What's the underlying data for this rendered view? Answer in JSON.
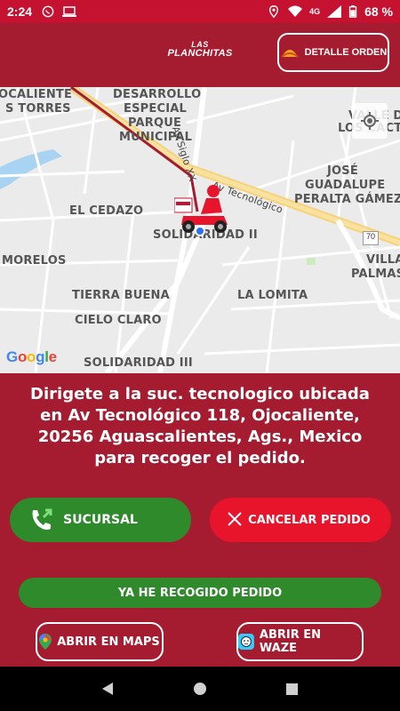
{
  "statusbar": {
    "time": "2:24",
    "battery": "68 %",
    "network": "4G"
  },
  "header": {
    "logo_line1": "LAS",
    "logo_line2": "PLANCHITAS",
    "detalle_label": "DETALLE ORDEN"
  },
  "map": {
    "labels": {
      "ojocaliente": "OCALIENTE",
      "las_torres": "S TORRES",
      "desarrollo": "DESARROLLO",
      "especial": "ESPECIAL",
      "parque": "PARQUE",
      "municipal": "MUNICIPAL",
      "av_siglo": "Av Siglo XX",
      "valle": "VALLE DE",
      "los_cactus": "LOS CACTU",
      "jose": "JOSÉ",
      "guadalupe": "GUADALUPE",
      "peralta": "PERALTA GÁMEZ",
      "av_tecnologico": "Av Tecnológico",
      "el_cedazo": "EL CEDAZO",
      "solidaridad2": "SOLIDARIDAD II",
      "route70": "70",
      "morelos": "MORELOS",
      "villa": "VILLA",
      "palmas": "PALMAS",
      "tierra_buena": "TIERRA BUENA",
      "la_lomita": "LA LOMITA",
      "cielo_claro": "CIELO CLARO",
      "solidaridad3": "SOLIDARIDAD III",
      "google": "Google"
    }
  },
  "message": "Dirigete a la suc. tecnologico ubicada en Av Tecnológico 118, Ojocaliente, 20256 Aguascalientes, Ags., Mexico para recoger el pedido.",
  "buttons": {
    "sucursal": "SUCURSAL",
    "cancelar": "CANCELAR PEDIDO",
    "recogido": "YA HE RECOGIDO PEDIDO",
    "maps": "ABRIR EN MAPS",
    "waze": "ABRIR EN WAZE"
  },
  "colors": {
    "brand": "#a51c30",
    "statusbar": "#c41230",
    "green": "#2e8a2a",
    "red": "#e8142c"
  }
}
